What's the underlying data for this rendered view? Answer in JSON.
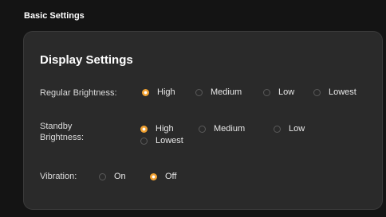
{
  "section_title": "Basic Settings",
  "panel_title": "Display Settings",
  "regular": {
    "label": "Regular Brightness:",
    "options": [
      "High",
      "Medium",
      "Low",
      "Lowest"
    ],
    "selected": "High"
  },
  "standby": {
    "label": "Standby Brightness:",
    "options": [
      "High",
      "Medium",
      "Low",
      "Lowest"
    ],
    "selected": "High"
  },
  "vibration": {
    "label": "Vibration:",
    "options": [
      "On",
      "Off"
    ],
    "selected": "Off"
  },
  "colors": {
    "accent": "#f0a030",
    "panel": "#2a2a2a",
    "background": "#141414"
  }
}
